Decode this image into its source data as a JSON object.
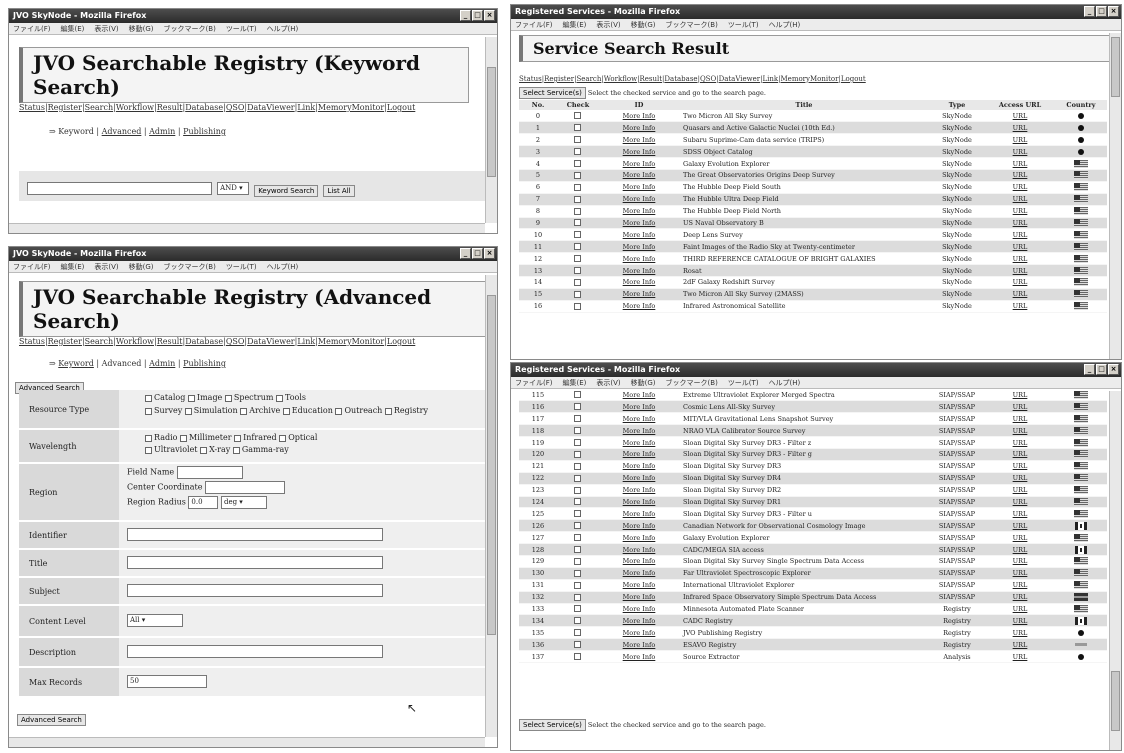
{
  "windows": {
    "keyword": {
      "title": "JVO SkyNode - Mozilla Firefox",
      "menu": [
        "ファイル(F)",
        "編集(E)",
        "表示(V)",
        "移動(G)",
        "ブックマーク(B)",
        "ツール(T)",
        "ヘルプ(H)"
      ],
      "heading": "JVO Searchable Registry (Keyword Search)",
      "nav": [
        "Status",
        "Register",
        "Search",
        "Workflow",
        "Result",
        "Database",
        "QSO",
        "DataViewer",
        "Link",
        "MemoryMonitor",
        "Logout"
      ],
      "subnav": [
        "Keyword",
        "Advanced",
        "Admin",
        "Publishing"
      ],
      "select_value": "AND",
      "buttons": {
        "search": "Keyword Search",
        "list_all": "List All"
      }
    },
    "advanced": {
      "title": "JVO SkyNode - Mozilla Firefox",
      "menu": [
        "ファイル(F)",
        "編集(E)",
        "表示(V)",
        "移動(G)",
        "ブックマーク(B)",
        "ツール(T)",
        "ヘルプ(H)"
      ],
      "heading": "JVO Searchable Registry (Advanced Search)",
      "nav": [
        "Status",
        "Register",
        "Search",
        "Workflow",
        "Result",
        "Database",
        "QSO",
        "DataViewer",
        "Link",
        "MemoryMonitor",
        "Logout"
      ],
      "subnav": [
        "Keyword",
        "Advanced",
        "Admin",
        "Publishing"
      ],
      "button": "Advanced Search",
      "fields": {
        "resource_type": {
          "label": "Resource Type",
          "line1": [
            "Catalog",
            "Image",
            "Spectrum",
            "Tools"
          ],
          "line2": [
            "Survey",
            "Simulation",
            "Archive",
            "Education",
            "Outreach",
            "Registry"
          ]
        },
        "wavelength": {
          "label": "Wavelength",
          "line1": [
            "Radio",
            "Millimeter",
            "Infrared",
            "Optical"
          ],
          "line2": [
            "Ultraviolet",
            "X-ray",
            "Gamma-ray"
          ]
        },
        "region": {
          "label": "Region",
          "field_name": "Field Name",
          "center": "Center Coordinate",
          "radius": "Region Radius",
          "radius_value": "0.0",
          "radius_unit": "deg"
        },
        "identifier": "Identifier",
        "title": "Title",
        "subject": "Subject",
        "content_level": {
          "label": "Content Level",
          "value": "All"
        },
        "description": "Description",
        "max_records": {
          "label": "Max Records",
          "value": "50"
        }
      }
    },
    "result": {
      "title": "Registered Services - Mozilla Firefox",
      "menu": [
        "ファイル(F)",
        "編集(E)",
        "表示(V)",
        "移動(G)",
        "ブックマーク(B)",
        "ツール(T)",
        "ヘルプ(H)"
      ],
      "heading": "Service Search Result",
      "nav": [
        "Status",
        "Register",
        "Search",
        "Workflow",
        "Result",
        "Database",
        "QSO",
        "DataViewer",
        "Link",
        "MemoryMonitor",
        "Logout"
      ],
      "select_button": "Select Service(s)",
      "select_hint": "Select the checked service and go to the search page.",
      "columns": [
        "No.",
        "Check",
        "ID",
        "Title",
        "Type",
        "Access URL",
        "Country"
      ],
      "rows": [
        {
          "no": "0",
          "title": "Two Micron All Sky Survey",
          "type": "SkyNode",
          "country": "jp"
        },
        {
          "no": "1",
          "title": "Quasars and Active Galactic Nuclei (10th Ed.)",
          "type": "SkyNode",
          "country": "jp"
        },
        {
          "no": "2",
          "title": "Subaru Suprime-Cam data service (TRIPS)",
          "type": "SkyNode",
          "country": "jp"
        },
        {
          "no": "3",
          "title": "SDSS Object Catalog",
          "type": "SkyNode",
          "country": "jp"
        },
        {
          "no": "4",
          "title": "Galaxy Evolution Explorer",
          "type": "SkyNode",
          "country": "us"
        },
        {
          "no": "5",
          "title": "The Great Observatories Origins Deep Survey",
          "type": "SkyNode",
          "country": "us"
        },
        {
          "no": "6",
          "title": "The Hubble Deep Field South",
          "type": "SkyNode",
          "country": "us"
        },
        {
          "no": "7",
          "title": "The Hubble Ultra Deep Field",
          "type": "SkyNode",
          "country": "us"
        },
        {
          "no": "8",
          "title": "The Hubble Deep Field North",
          "type": "SkyNode",
          "country": "us"
        },
        {
          "no": "9",
          "title": "US Naval Observatory B",
          "type": "SkyNode",
          "country": "us"
        },
        {
          "no": "10",
          "title": "Deep Lens Survey",
          "type": "SkyNode",
          "country": "us"
        },
        {
          "no": "11",
          "title": "Faint Images of the Radio Sky at Twenty-centimeter",
          "type": "SkyNode",
          "country": "us"
        },
        {
          "no": "12",
          "title": "THIRD REFERENCE CATALOGUE OF BRIGHT GALAXIES",
          "type": "SkyNode",
          "country": "us"
        },
        {
          "no": "13",
          "title": "Rosat",
          "type": "SkyNode",
          "country": "us"
        },
        {
          "no": "14",
          "title": "2dF Galaxy Redshift Survey",
          "type": "SkyNode",
          "country": "us"
        },
        {
          "no": "15",
          "title": "Two Micron All Sky Survey (2MASS)",
          "type": "SkyNode",
          "country": "us"
        },
        {
          "no": "16",
          "title": "Infrared Astronomical Satellite",
          "type": "SkyNode",
          "country": "us"
        }
      ]
    },
    "result2": {
      "title": "Registered Services - Mozilla Firefox",
      "menu": [
        "ファイル(F)",
        "編集(E)",
        "表示(V)",
        "移動(G)",
        "ブックマーク(B)",
        "ツール(T)",
        "ヘルプ(H)"
      ],
      "select_button": "Select Service(s)",
      "select_hint": "Select the checked service and go to the search page.",
      "rows": [
        {
          "no": "115",
          "title": "Extreme Ultraviolet Explorer Merged Spectra",
          "type": "SIAP/SSAP",
          "country": "us"
        },
        {
          "no": "116",
          "title": "Cosmic Lens All-Sky Survey",
          "type": "SIAP/SSAP",
          "country": "us"
        },
        {
          "no": "117",
          "title": "MIT/VLA Gravitational Lens Snapshot Survey",
          "type": "SIAP/SSAP",
          "country": "us"
        },
        {
          "no": "118",
          "title": "NRAO VLA Calibrator Source Survey",
          "type": "SIAP/SSAP",
          "country": "us"
        },
        {
          "no": "119",
          "title": "Sloan Digital Sky Survey DR3 - Filter z",
          "type": "SIAP/SSAP",
          "country": "us"
        },
        {
          "no": "120",
          "title": "Sloan Digital Sky Survey DR3 - Filter g",
          "type": "SIAP/SSAP",
          "country": "us"
        },
        {
          "no": "121",
          "title": "Sloan Digital Sky Survey DR3",
          "type": "SIAP/SSAP",
          "country": "us"
        },
        {
          "no": "122",
          "title": "Sloan Digital Sky Survey DR4",
          "type": "SIAP/SSAP",
          "country": "us"
        },
        {
          "no": "123",
          "title": "Sloan Digital Sky Survey DR2",
          "type": "SIAP/SSAP",
          "country": "us"
        },
        {
          "no": "124",
          "title": "Sloan Digital Sky Survey DR1",
          "type": "SIAP/SSAP",
          "country": "us"
        },
        {
          "no": "125",
          "title": "Sloan Digital Sky Survey DR3 - Filter u",
          "type": "SIAP/SSAP",
          "country": "us"
        },
        {
          "no": "126",
          "title": "Canadian Network for Observational Cosmology Image",
          "type": "SIAP/SSAP",
          "country": "ca"
        },
        {
          "no": "127",
          "title": "Galaxy Evolution Explorer",
          "type": "SIAP/SSAP",
          "country": "us"
        },
        {
          "no": "128",
          "title": "CADC/MEGA SIA access",
          "type": "SIAP/SSAP",
          "country": "ca"
        },
        {
          "no": "129",
          "title": "Sloan Digital Sky Survey Single Spectrum Data Access",
          "type": "SIAP/SSAP",
          "country": "us"
        },
        {
          "no": "130",
          "title": "Far Ultraviolet Spectroscopic Explorer",
          "type": "SIAP/SSAP",
          "country": "us"
        },
        {
          "no": "131",
          "title": "International Ultraviolet Explorer",
          "type": "SIAP/SSAP",
          "country": "us"
        },
        {
          "no": "132",
          "title": "Infrared Space Observatory Simple Spectrum Data Access",
          "type": "SIAP/SSAP",
          "country": "gb"
        },
        {
          "no": "133",
          "title": "Minnesota Automated Plate Scanner",
          "type": "Registry",
          "country": "us"
        },
        {
          "no": "134",
          "title": "CADC Registry",
          "type": "Registry",
          "country": "ca"
        },
        {
          "no": "135",
          "title": "JVO Publishing Registry",
          "type": "Registry",
          "country": "jp"
        },
        {
          "no": "136",
          "title": "ESAVO Registry",
          "type": "Registry",
          "country": "eu"
        },
        {
          "no": "137",
          "title": "Source Extractor",
          "type": "Analysis",
          "country": "jp"
        }
      ]
    }
  },
  "row_labels": {
    "more": "More Info",
    "url": "URL"
  }
}
